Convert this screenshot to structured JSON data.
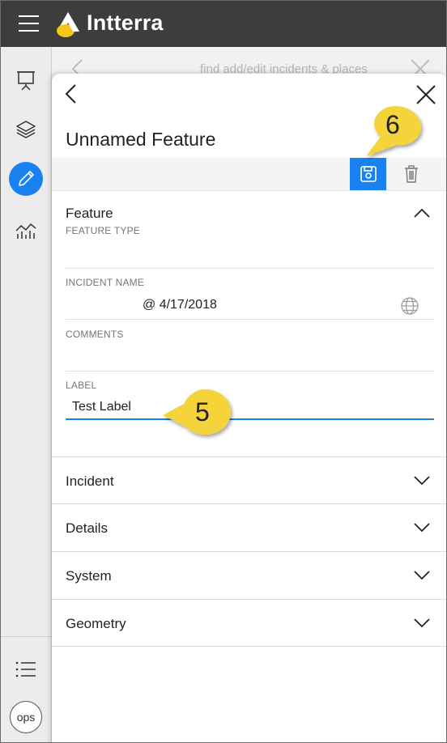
{
  "app": {
    "brand": "Intterra"
  },
  "sidebar": {
    "items": [
      {
        "name": "presentation-icon"
      },
      {
        "name": "layers-icon"
      },
      {
        "name": "pencil-icon"
      },
      {
        "name": "analytics-icon"
      }
    ],
    "bottom_items": [
      {
        "name": "list-icon"
      }
    ],
    "ops_label": "ops"
  },
  "background_panel": {
    "search_placeholder": "find add/edit incidents & places"
  },
  "panel": {
    "title": "Unnamed Feature",
    "sections": {
      "feature": {
        "header": "Feature",
        "fields": {
          "feature_type": {
            "label": "FEATURE TYPE",
            "value": ""
          },
          "incident_name": {
            "label": "INCIDENT NAME",
            "value": "@ 4/17/2018"
          },
          "comments": {
            "label": "COMMENTS",
            "value": ""
          },
          "label": {
            "label": "LABEL",
            "value": "Test Label"
          }
        }
      }
    },
    "collapsed_sections": [
      "Incident",
      "Details",
      "System",
      "Geometry"
    ]
  },
  "callouts": {
    "save": "6",
    "label": "5"
  },
  "colors": {
    "accent": "#1a82f0",
    "topbar": "#3d3d3d",
    "callout": "#f5d43a"
  }
}
